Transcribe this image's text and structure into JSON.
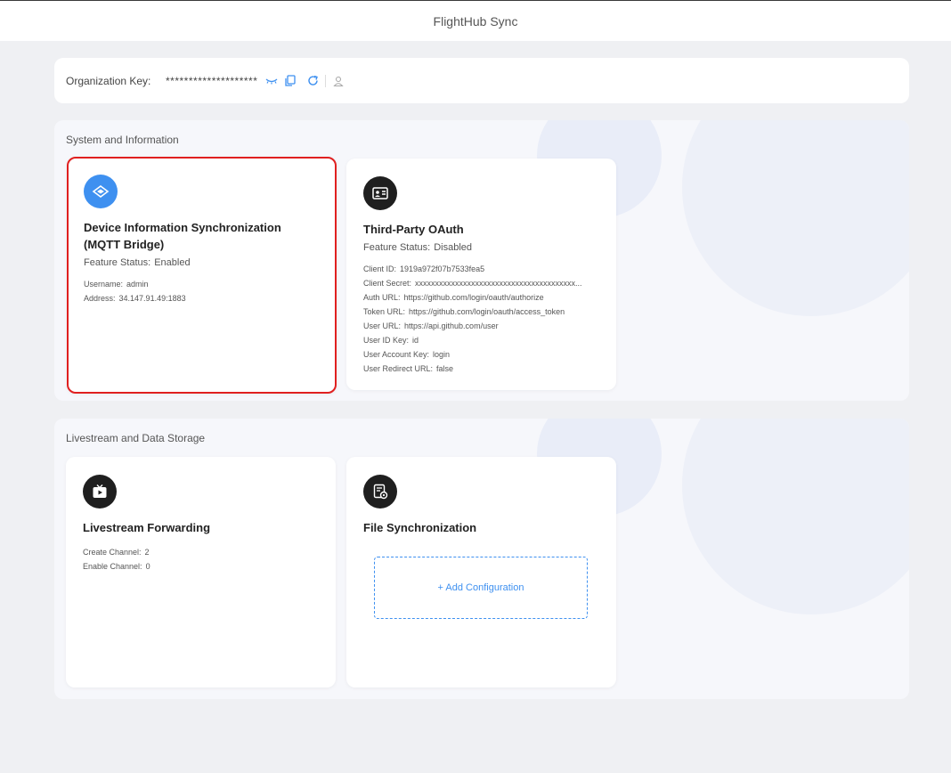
{
  "app": {
    "title": "FlightHub Sync"
  },
  "org": {
    "label": "Organization Key:",
    "key": "********************"
  },
  "sections": {
    "system": {
      "title": "System and Information",
      "mqtt": {
        "title": "Device Information Synchronization (MQTT Bridge)",
        "status_label": "Feature Status:",
        "status_value": "Enabled",
        "fields": [
          {
            "k": "Username:",
            "v": "admin"
          },
          {
            "k": "Address:",
            "v": "34.147.91.49:1883"
          }
        ]
      },
      "oauth": {
        "title": "Third-Party OAuth",
        "status_label": "Feature Status:",
        "status_value": "Disabled",
        "fields": [
          {
            "k": "Client ID:",
            "v": "1919a972f07b7533fea5"
          },
          {
            "k": "Client Secret:",
            "v": "xxxxxxxxxxxxxxxxxxxxxxxxxxxxxxxxxxxxxxxx..."
          },
          {
            "k": "Auth URL:",
            "v": "https://github.com/login/oauth/authorize"
          },
          {
            "k": "Token URL:",
            "v": "https://github.com/login/oauth/access_token"
          },
          {
            "k": "User URL:",
            "v": "https://api.github.com/user"
          },
          {
            "k": "User ID Key:",
            "v": "id"
          },
          {
            "k": "User Account Key:",
            "v": "login"
          },
          {
            "k": "User Redirect URL:",
            "v": "false"
          }
        ]
      }
    },
    "livestream": {
      "title": "Livestream and Data Storage",
      "forwarding": {
        "title": "Livestream Forwarding",
        "fields": [
          {
            "k": "Create Channel:",
            "v": "2"
          },
          {
            "k": "Enable Channel:",
            "v": "0"
          }
        ]
      },
      "filesync": {
        "title": "File Synchronization",
        "add_label": "+ Add Configuration"
      }
    }
  },
  "colors": {
    "accent": "#3e90f0",
    "selected_border": "#e02020"
  }
}
